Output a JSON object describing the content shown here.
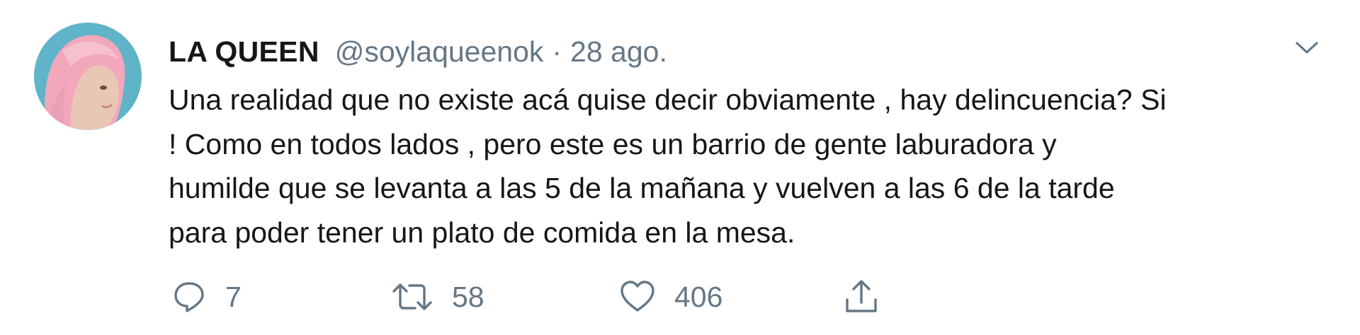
{
  "tweet": {
    "display_name": "LA QUEEN",
    "handle": "@soylaqueenok",
    "separator": "·",
    "date": "28 ago.",
    "text_lines": [
      "Una realidad que no existe acá quise decir obviamente , hay delincuencia? Si",
      "! Como en todos lados , pero este es un barrio de gente laburadora y",
      "humilde que se levanta a las 5 de la mañana y vuelven a las 6 de la tarde",
      "para poder tener un plato de comida en la mesa."
    ]
  },
  "actions": {
    "reply": {
      "icon": "reply-icon",
      "count": "7"
    },
    "retweet": {
      "icon": "retweet-icon",
      "count": "58"
    },
    "like": {
      "icon": "heart-icon",
      "count": "406"
    },
    "share": {
      "icon": "share-icon"
    }
  },
  "menu": {
    "icon": "chevron-down-icon"
  },
  "colors": {
    "text": "#14171a",
    "secondary": "#657786",
    "avatar_bg": "#5fb4c9",
    "avatar_hair": "#f2a7bb"
  }
}
